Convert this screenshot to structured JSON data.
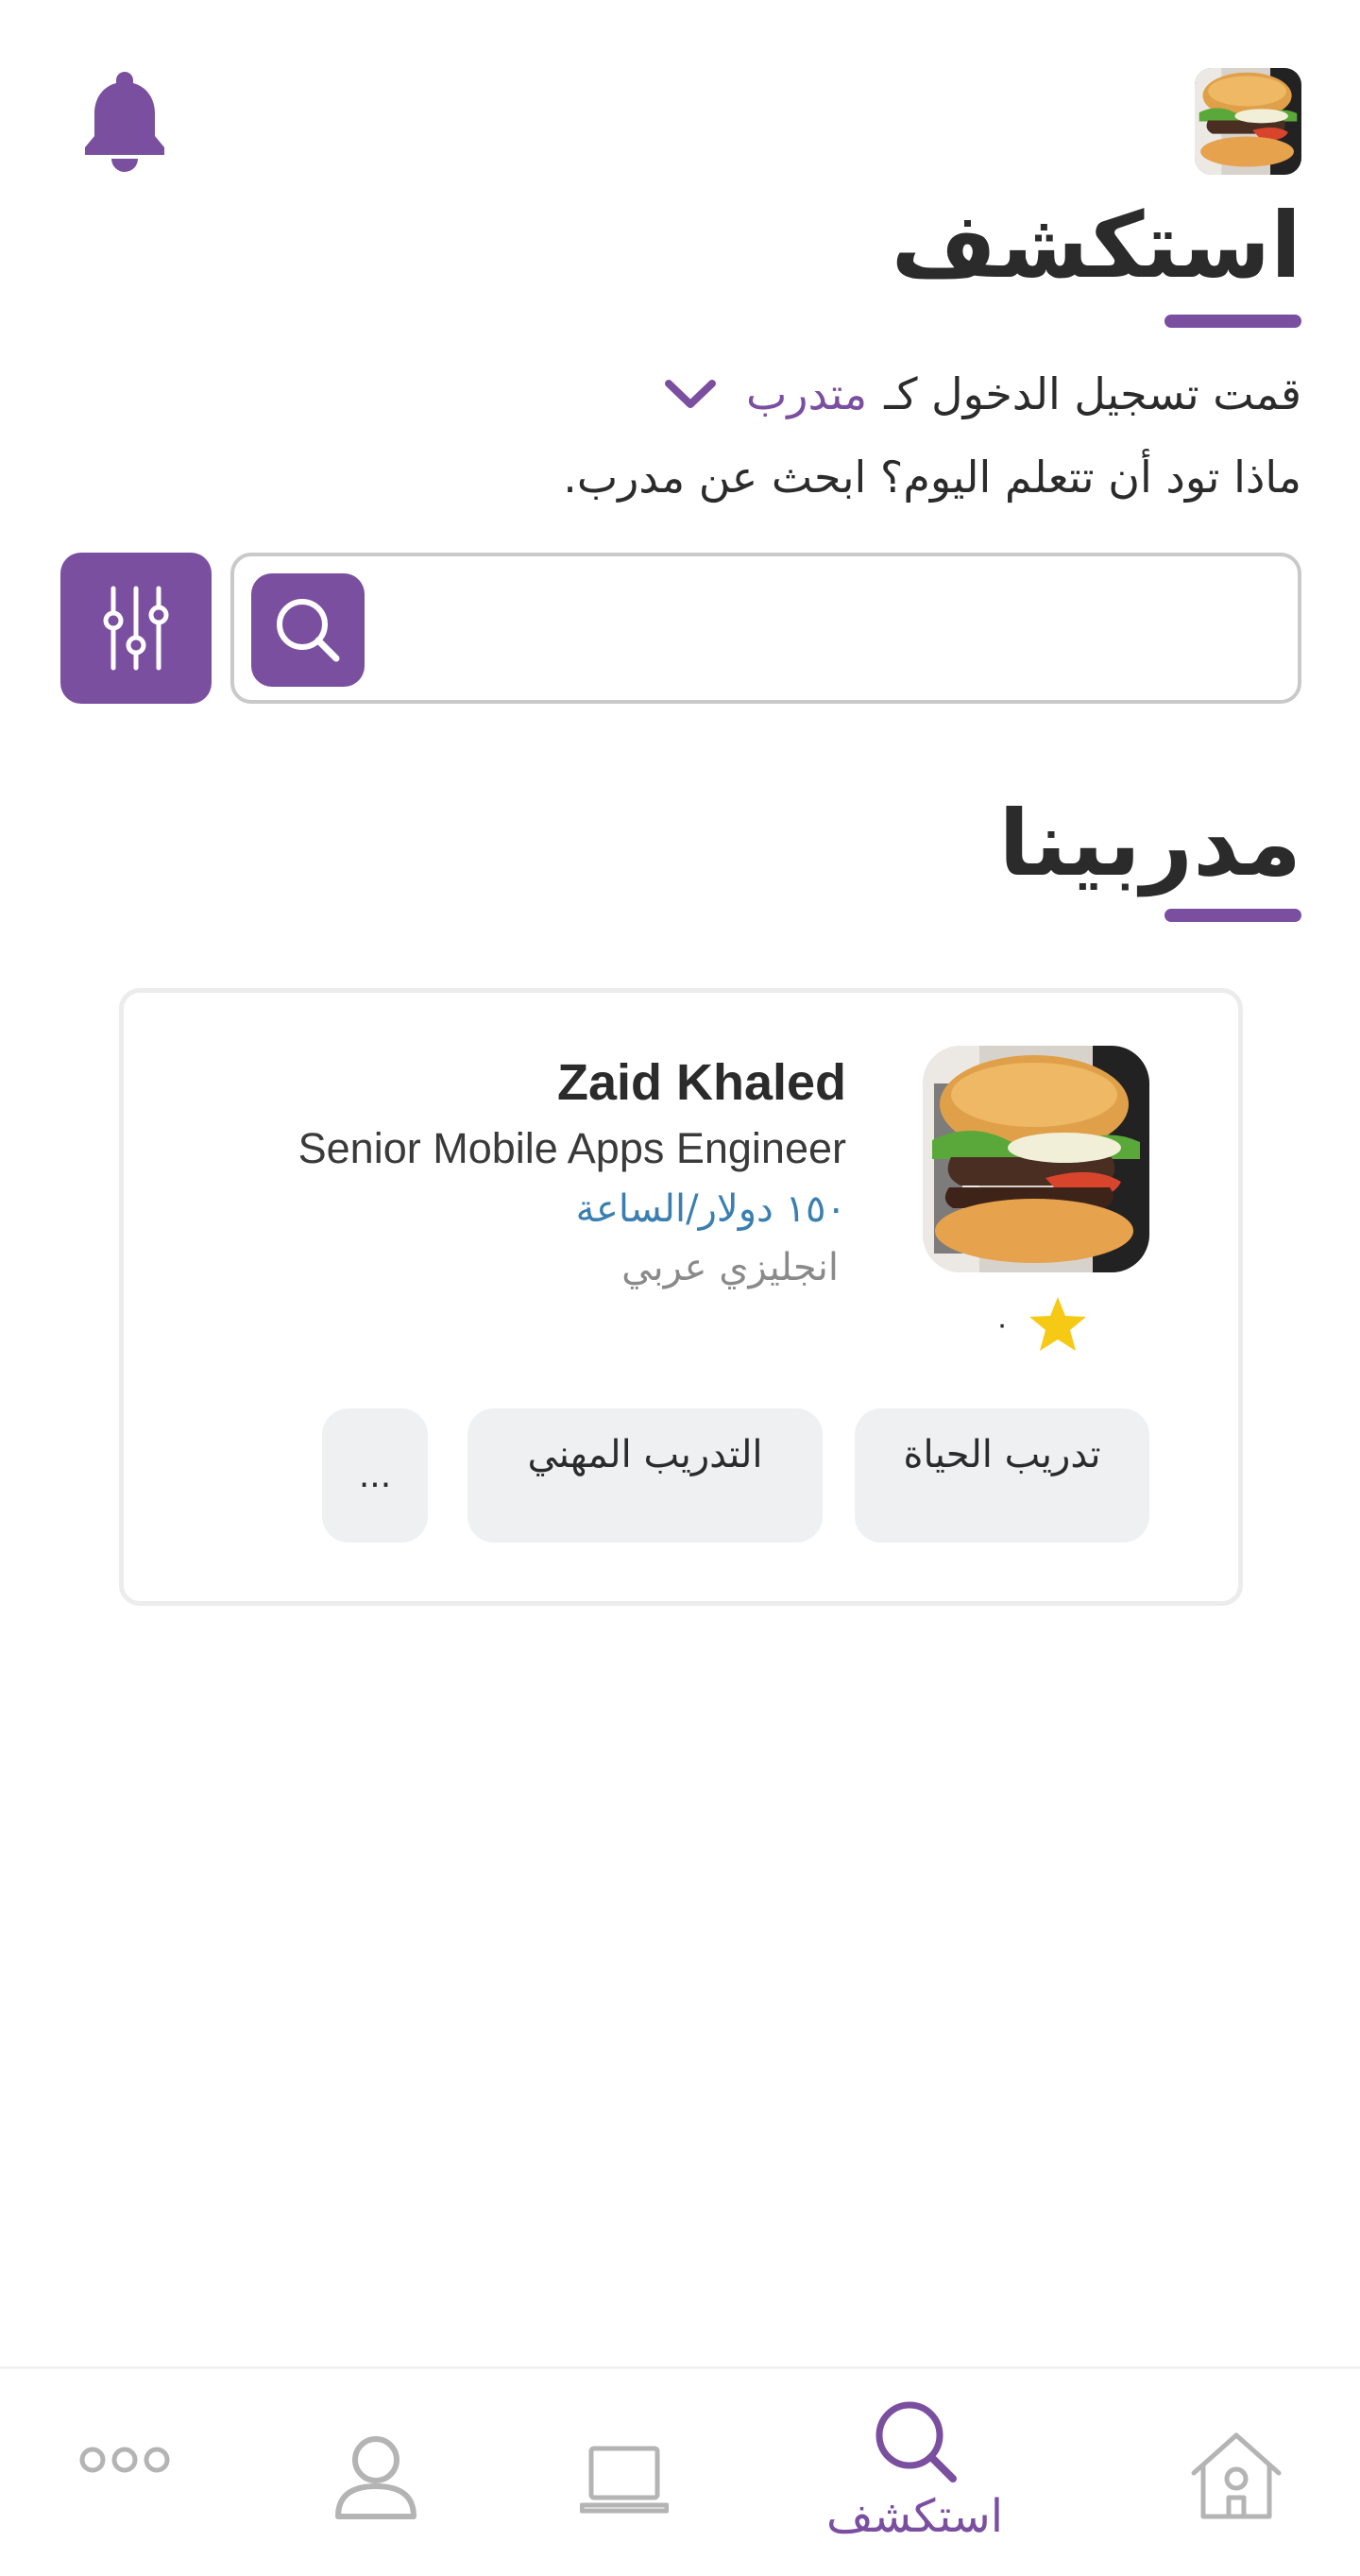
{
  "header": {
    "title": "استكشف",
    "login_prefix": "قمت تسجيل الدخول كـ",
    "role_selected": "متدرب",
    "prompt": "ماذا تود أن تتعلم اليوم؟ ابحث عن مدرب.",
    "icons": {
      "notifications": "bell-icon",
      "avatar": "user-avatar"
    }
  },
  "search": {
    "value": "",
    "placeholder": "",
    "icons": {
      "search": "search-icon",
      "filter": "sliders-icon"
    }
  },
  "trainers_section": {
    "title": "مدربينا",
    "cards": [
      {
        "name": "Zaid Khaled",
        "role": "Senior Mobile Apps Engineer",
        "rate": "١٥٠ دولار/الساعة",
        "languages": "انجليزي عربي",
        "rating": "٠",
        "tags": [
          "تدريب الحياة",
          "التدريب المهني",
          "..."
        ]
      }
    ]
  },
  "bottom_nav": {
    "items": [
      {
        "id": "home",
        "icon": "home-icon",
        "label": ""
      },
      {
        "id": "explore",
        "icon": "search-icon",
        "label": "استكشف",
        "active": true
      },
      {
        "id": "courses",
        "icon": "laptop-icon",
        "label": ""
      },
      {
        "id": "profile",
        "icon": "user-icon",
        "label": ""
      },
      {
        "id": "more",
        "icon": "more-icon",
        "label": ""
      }
    ]
  },
  "colors": {
    "accent": "#7b4fa0",
    "rate_text": "#3b7fb0",
    "tag_background": "#eef0f1",
    "star": "#f6c915",
    "inactive_icon": "#b4b4b4"
  }
}
